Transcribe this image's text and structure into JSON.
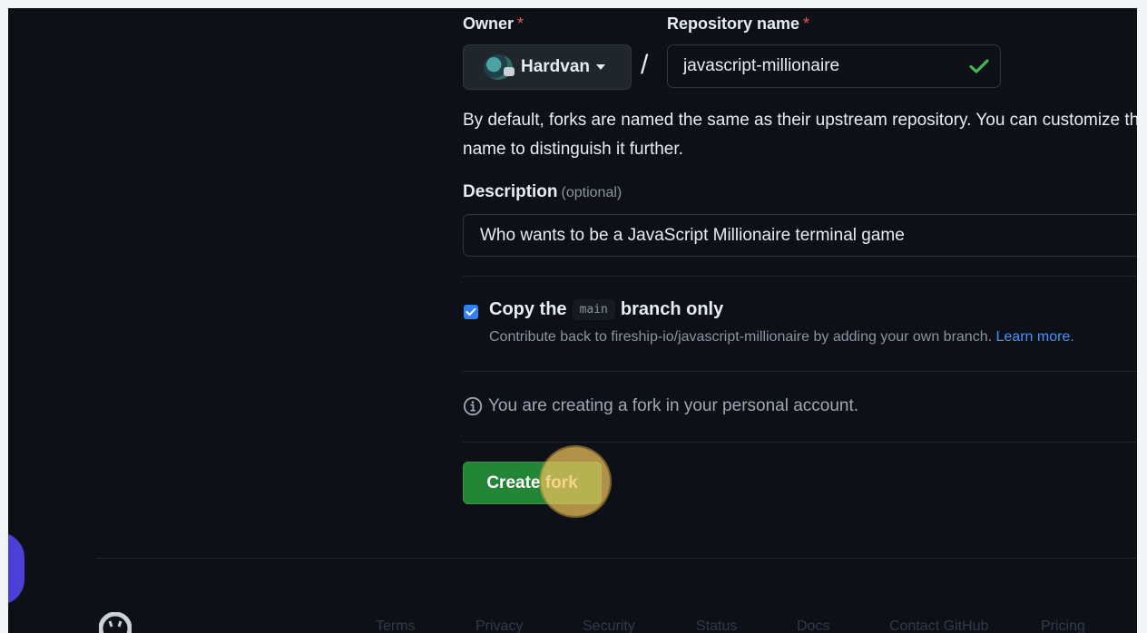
{
  "form": {
    "owner_label": "Owner",
    "required_mark": "*",
    "repo_label": "Repository name",
    "owner_name": "Hardvan",
    "separator": "/",
    "repo_value": "javascript-millionaire",
    "help_text": "By default, forks are named the same as their upstream repository. You can customize the name to distinguish it further.",
    "description_label": "Description",
    "description_optional": "(optional)",
    "description_value": "Who wants to be a JavaScript Millionaire terminal game",
    "copy_prefix": "Copy the",
    "copy_branch": "main",
    "copy_suffix": "branch only",
    "copy_checked": true,
    "contribute_text": "Contribute back to fireship-io/javascript-millionaire by adding your own branch.",
    "learn_more": "Learn more.",
    "info_text": "You are creating a fork in your personal account.",
    "create_button": "Create fork"
  },
  "footer": {
    "links": [
      "Terms",
      "Privacy",
      "Security",
      "Status",
      "Docs",
      "Contact GitHub",
      "Pricing"
    ]
  },
  "colors": {
    "background": "#0d1117",
    "primary_button": "#238636",
    "link": "#4493f8",
    "checkbox": "#2f81f7",
    "required": "#f85149",
    "click_highlight": "#f1c45c"
  },
  "icons": {
    "check": "check-icon",
    "info": "info-icon",
    "caret": "caret-down-icon",
    "github": "github-mark-icon"
  }
}
